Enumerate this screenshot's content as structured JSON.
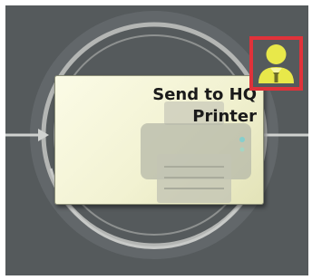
{
  "activity": {
    "label_line1": "Send to HQ",
    "label_line2": "Printer",
    "icon": "printer-icon"
  },
  "assignment": {
    "icon": "user-icon",
    "highlight_color": "#e0323a",
    "icon_color": "#e8e84a"
  },
  "colors": {
    "canvas_background": "#555a5c",
    "card_background": "#f5f5d8",
    "ring": "#b4b6b4"
  }
}
